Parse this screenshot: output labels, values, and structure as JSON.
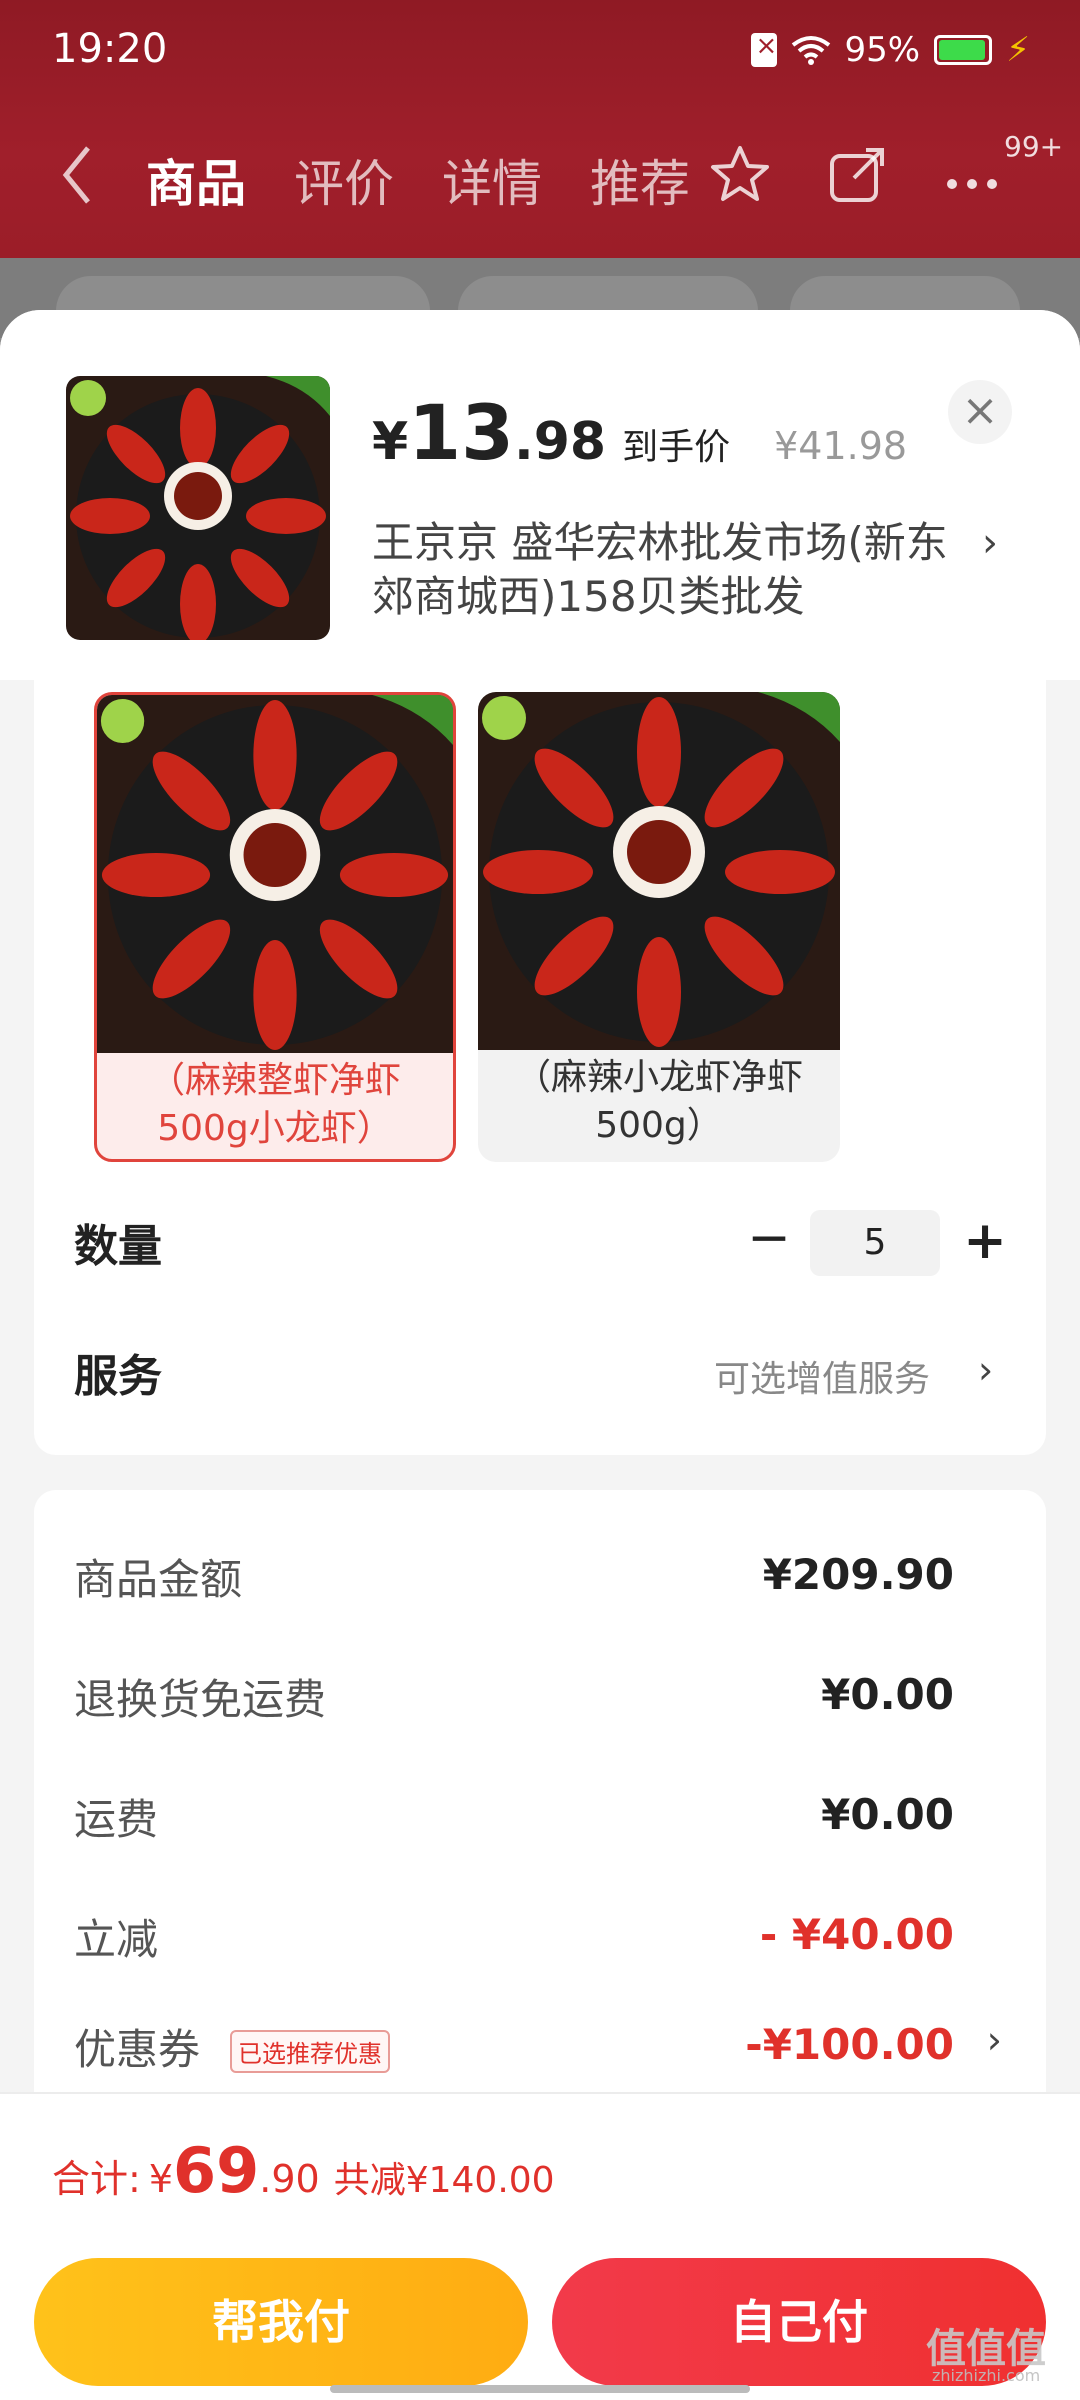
{
  "status_bar": {
    "time": "19:20",
    "battery": "95%"
  },
  "nav": {
    "tabs": [
      "商品",
      "评价",
      "详情",
      "推荐"
    ],
    "active_tab": "商品",
    "badge": "99+"
  },
  "product": {
    "price_yen": "¥",
    "price_int": "13",
    "price_dec": ".98",
    "price_label": "到手价",
    "original_price": "¥41.98",
    "shop": "王京京  盛华宏林批发市场(新东郊商城西)158贝类批发"
  },
  "variants": [
    {
      "label": "（麻辣整虾净虾500g小龙虾）",
      "selected": true
    },
    {
      "label": "（麻辣小龙虾净虾500g）",
      "selected": false
    }
  ],
  "quantity": {
    "label": "数量",
    "value": "5",
    "minus": "−",
    "plus": "+"
  },
  "service": {
    "label": "服务",
    "hint": "可选增值服务"
  },
  "fees": {
    "goods_amount": {
      "label": "商品金额",
      "value": "¥209.90"
    },
    "return_shipping": {
      "label": "退换货免运费",
      "value": "¥0.00"
    },
    "shipping": {
      "label": "运费",
      "value": "¥0.00"
    },
    "discount": {
      "label": "立减",
      "value": "- ¥40.00"
    },
    "coupon": {
      "label": "优惠券",
      "tag": "已选推荐优惠",
      "value": "-¥100.00"
    }
  },
  "total": {
    "label": "合计:",
    "yen": "¥",
    "int": "69",
    "dec": ".90",
    "saved": "共减¥140.00"
  },
  "buttons": {
    "help_pay": "帮我付",
    "self_pay": "自己付"
  },
  "watermark": {
    "text": "值值值",
    "sub": "zhizhizhi.com"
  },
  "colors": {
    "accent_red": "#e0312b",
    "header_red": "#a01f2b",
    "help_btn": "#ffb515",
    "self_btn": "#f03434"
  }
}
